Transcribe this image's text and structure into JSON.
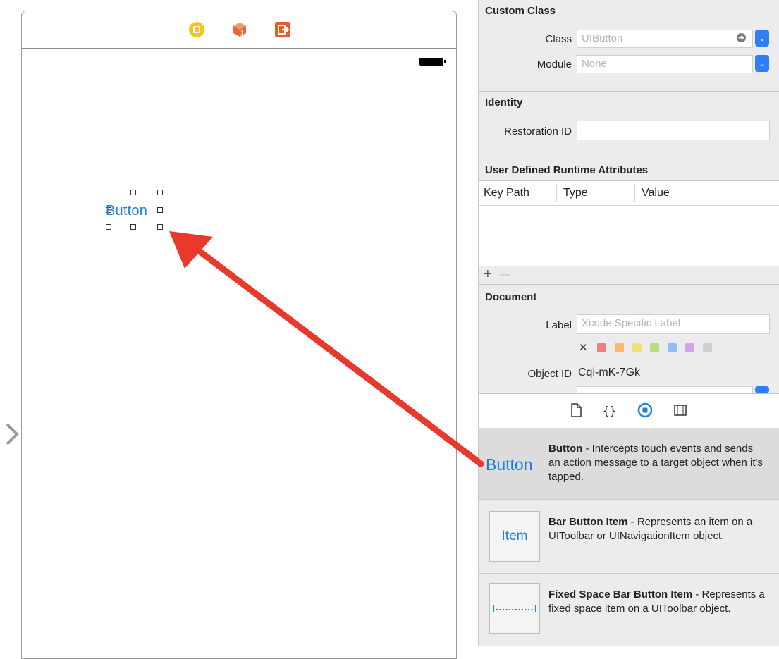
{
  "canvas": {
    "button_text": "Button",
    "dock_icons": [
      "view-controller-icon",
      "first-responder-icon",
      "exit-icon"
    ],
    "colors": {
      "view_controller": "#f5c518",
      "first_responder": "#e8683a",
      "exit": "#ea5b30",
      "button_blue": "#1a7fe5",
      "arrow": "#e8392c"
    }
  },
  "inspector": {
    "custom_class": {
      "title": "Custom Class",
      "class_label": "Class",
      "class_placeholder": "UIButton",
      "module_label": "Module",
      "module_placeholder": "None"
    },
    "identity": {
      "title": "Identity",
      "restoration_label": "Restoration ID",
      "restoration_value": ""
    },
    "runtime_attributes": {
      "title": "User Defined Runtime Attributes",
      "columns": [
        "Key Path",
        "Type",
        "Value"
      ],
      "add_label": "+",
      "remove_label": "—"
    },
    "document": {
      "title": "Document",
      "label_label": "Label",
      "label_placeholder": "Xcode Specific Label",
      "clear_label": "✕",
      "color_swatches": [
        "#f08080",
        "#f5b971",
        "#f3e07a",
        "#b9dc7e",
        "#8fbff2",
        "#d7a3e8",
        "#cfcfcf"
      ],
      "object_id_label": "Object ID",
      "object_id_value": "Cqi-mK-7Gk"
    },
    "tabs": [
      "file-template-icon",
      "code-snippet-icon",
      "object-library-icon",
      "media-library-icon"
    ],
    "library": [
      {
        "title": "Button",
        "desc": " - Intercepts touch events and sends an action message to a target object when it's tapped.",
        "preview": "Button"
      },
      {
        "title": "Bar Button Item",
        "desc": " - Represents an item on a UIToolbar or UINavigationItem object.",
        "preview": "Item"
      },
      {
        "title": "Fixed Space Bar Button Item",
        "desc": " - Represents a fixed space item on a UIToolbar object.",
        "preview": ""
      }
    ]
  }
}
